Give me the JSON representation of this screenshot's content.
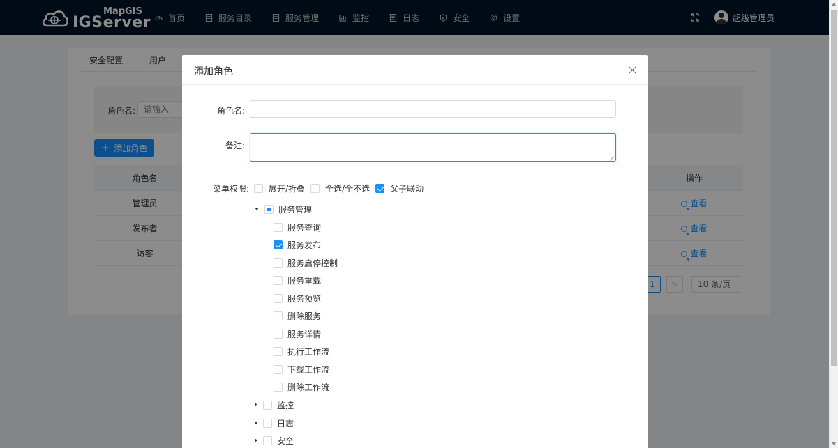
{
  "app": {
    "brand_top": "MapGIS",
    "brand_main": "IGServer"
  },
  "nav": {
    "items": [
      {
        "label": "首页",
        "icon": "dashboard-icon"
      },
      {
        "label": "服务目录",
        "icon": "catalog-icon"
      },
      {
        "label": "服务管理",
        "icon": "service-manage-icon"
      },
      {
        "label": "监控",
        "icon": "chart-icon"
      },
      {
        "label": "日志",
        "icon": "log-icon"
      },
      {
        "label": "安全",
        "icon": "shield-icon"
      },
      {
        "label": "设置",
        "icon": "gear-icon"
      }
    ],
    "username": "超级管理员"
  },
  "page": {
    "tabs": [
      "安全配置",
      "用户"
    ],
    "filter_label": "角色名:",
    "filter_placeholder": "请输入",
    "add_button": "添加角色",
    "table": {
      "headers": {
        "name": "角色名",
        "op": "操作"
      },
      "rows": [
        {
          "name": "管理员",
          "op": "查看"
        },
        {
          "name": "发布者",
          "op": "查看"
        },
        {
          "name": "访客",
          "op": "查看"
        }
      ]
    },
    "pager": {
      "current": "1",
      "next": ">",
      "page_size": "10 条/页"
    }
  },
  "modal": {
    "title": "添加角色",
    "role_name_label": "角色名:",
    "role_name_value": "",
    "remark_label": "备注:",
    "remark_value": "",
    "perm_label": "菜单权限:",
    "perm_options": [
      {
        "label": "展开/折叠",
        "checked": false
      },
      {
        "label": "全选/全不选",
        "checked": false
      },
      {
        "label": "父子联动",
        "checked": true
      }
    ],
    "tree": {
      "root": {
        "label": "服务管理",
        "state": "indeterminate",
        "expanded": true
      },
      "children": [
        {
          "label": "服务查询",
          "checked": false
        },
        {
          "label": "服务发布",
          "checked": true
        },
        {
          "label": "服务启停控制",
          "checked": false
        },
        {
          "label": "服务重载",
          "checked": false
        },
        {
          "label": "服务预览",
          "checked": false
        },
        {
          "label": "删除服务",
          "checked": false
        },
        {
          "label": "服务详情",
          "checked": false
        },
        {
          "label": "执行工作流",
          "checked": false
        },
        {
          "label": "下载工作流",
          "checked": false
        },
        {
          "label": "删除工作流",
          "checked": false
        }
      ],
      "siblings": [
        {
          "label": "监控",
          "checked": false
        },
        {
          "label": "日志",
          "checked": false
        },
        {
          "label": "安全",
          "checked": false
        }
      ]
    }
  }
}
